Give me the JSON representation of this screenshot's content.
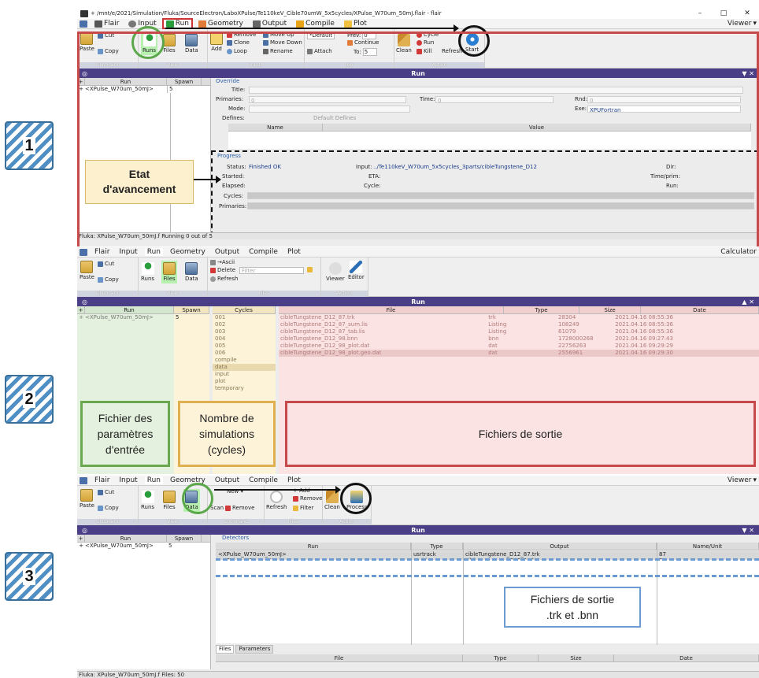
{
  "steps": [
    "1",
    "2",
    "3"
  ],
  "window": {
    "title": "+ /mnt/e/2021/Simulation/Fluka/SourceElectron/LaboXPulse/Te110keV_Cible70umW_5x5cycles/XPulse_W70um_50mJ.flair - flair",
    "min": "–",
    "max": "□",
    "close": "✕"
  },
  "tabs": {
    "flair": "Flair",
    "input": "Input",
    "run": "Run",
    "geometry": "Geometry",
    "output": "Output",
    "compile": "Compile",
    "plot": "Plot",
    "viewer": "Viewer",
    "calculator": "Calculator"
  },
  "groups": {
    "clipboard": "Clipboard",
    "view": "View",
    "input": "Input",
    "job": "Job",
    "action": "Action",
    "files": "Files",
    "command": "Command"
  },
  "ribbon": {
    "paste": "Paste",
    "cut": "Cut",
    "copy": "Copy",
    "runs": "Runs",
    "files": "Files",
    "data": "Data",
    "add": "Add",
    "remove": "Remove",
    "clone": "Clone",
    "loop": "Loop",
    "move_up": "Move Up",
    "move_down": "Move Down",
    "rename": "Rename",
    "default_sel": "*Default",
    "attach": "Attach",
    "prev": "Prev:",
    "prev_val": "0",
    "continue": "Continue",
    "no": "No:",
    "no_val": "5",
    "to": "To:",
    "to_val": "5",
    "clean": "Clean",
    "cycle": "Cycle",
    "run": "Run",
    "kill": "Kill",
    "refresh": "Refresh",
    "start": "Start",
    "ascii": "→Ascii",
    "delete": "Delete",
    "filter_ph": "Filter",
    "viewer": "Viewer",
    "editor": "Editor",
    "new": "New ▾",
    "scan": "Scan",
    "add_plus": "+ Add",
    "process": "Process",
    "filter": "Filter"
  },
  "panel_title": "Run",
  "cols": {
    "run": "Run",
    "spawn": "Spawn",
    "cycles": "Cycles",
    "file": "File",
    "type": "Type",
    "size": "Size",
    "date": "Date",
    "output": "Output",
    "name_unit": "Name/Unit",
    "name": "Name",
    "value": "Value"
  },
  "run_entry": "<XPulse_W70um_50mJ>",
  "spawn_val": "5",
  "override": {
    "legend": "Override",
    "title": "Title:",
    "primaries": "Primaries:",
    "primaries_val": "0",
    "time": "Time:",
    "time_val": "0",
    "rnd": "Rnd:",
    "rnd_val": "0",
    "mode": "Mode:",
    "exe": "Exe:",
    "exe_val": "XPUFortran",
    "defines": "Defines:",
    "default_defines": "Default Defines"
  },
  "progress": {
    "legend": "Progress",
    "status": "Status:",
    "status_val": "Finished OK",
    "input": "Input:",
    "input_val": "../Te110keV_W70um_5x5cycles_3parts/cibleTungstene_D12",
    "dir": "Dir:",
    "started": "Started:",
    "eta": "ETA:",
    "timeprim": "Time/prim:",
    "elapsed": "Elapsed:",
    "cycle": "Cycle:",
    "run": "Run:",
    "cycles": "Cycles:",
    "primaries": "Primaries:"
  },
  "status1": "Fluka: XPulse_W70um_50mJ.f Running 0 out of 5",
  "status3": "Fluka: XPulse_W70um_50mJ.f Files: 50",
  "callout1": "Etat\nd'avancement",
  "cycles": [
    "001",
    "002",
    "003",
    "004",
    "005",
    "006",
    "compile",
    "data",
    "input",
    "plot",
    "temporary"
  ],
  "files": [
    {
      "name": "cibleTungstene_D12_87.trk",
      "type": "trk",
      "size": "28304",
      "date": "2021.04.16 08:55:36"
    },
    {
      "name": "cibleTungstene_D12_87_sum.lis",
      "type": "Listing",
      "size": "108249",
      "date": "2021.04.16 08:55:36"
    },
    {
      "name": "cibleTungstene_D12_87_tab.lis",
      "type": "Listing",
      "size": "61079",
      "date": "2021.04.16 08:55:36"
    },
    {
      "name": "cibleTungstene_D12_98.bnn",
      "type": "bnn",
      "size": "1728000268",
      "date": "2021.04.16 09:27:43"
    },
    {
      "name": "cibleTungstene_D12_98_plot.dat",
      "type": "dat",
      "size": "22756263",
      "date": "2021.04.16 09:29:29"
    },
    {
      "name": "cibleTungstene_D12_98_plot.geo.dat",
      "type": "dat",
      "size": "2556961",
      "date": "2021.04.16 09:29:30"
    }
  ],
  "callout2": {
    "input": "Fichier des\nparamètres\nd'entrée",
    "cycles": "Nombre de\nsimulations\n(cycles)",
    "outputs": "Fichiers de sortie"
  },
  "detectors": {
    "legend": "Detectors",
    "rows": [
      {
        "run": "<XPulse_W70um_50mJ>",
        "type": "usrtrack",
        "output": "cibleTungstene_D12_87.trk",
        "unit": "87"
      },
      {
        "run": "<XPulse_W70um_50mJ>",
        "type": "usrbin",
        "output": "cibleTungstene_D12_98.bnn",
        "unit": "98"
      }
    ]
  },
  "bottom_tabs": {
    "files": "Files",
    "parameters": "Parameters"
  },
  "callout3": "Fichiers de sortie\n.trk et .bnn",
  "colors": {
    "header": "#4a3f86",
    "red": "#c8494a",
    "green": "#6aa84f",
    "yellow": "#e0b050",
    "blue": "#6c9bd2",
    "step": "#4f8fc4"
  }
}
